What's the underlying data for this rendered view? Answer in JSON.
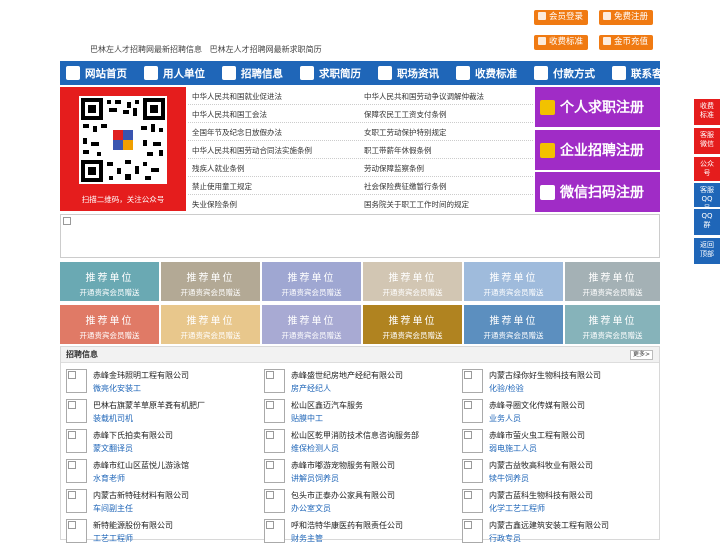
{
  "top_buttons": [
    {
      "label": "会员登录",
      "icon": "user-icon"
    },
    {
      "label": "免费注册",
      "icon": "register-icon"
    },
    {
      "label": "收费标准",
      "icon": "price-icon"
    },
    {
      "label": "金币充值",
      "icon": "coin-icon"
    }
  ],
  "tagline": "巴林左人才招聘网最新招聘信息   巴林左人才招聘网最新求职简历",
  "nav": [
    {
      "label": "网站首页",
      "icon": "home-icon"
    },
    {
      "label": "用人单位",
      "icon": "building-icon"
    },
    {
      "label": "招聘信息",
      "icon": "recruit-icon"
    },
    {
      "label": "求职简历",
      "icon": "resume-icon"
    },
    {
      "label": "职场资讯",
      "icon": "news-icon"
    },
    {
      "label": "收费标准",
      "icon": "fee-icon"
    },
    {
      "label": "付款方式",
      "icon": "payment-icon"
    },
    {
      "label": "联系客服",
      "icon": "service-icon"
    }
  ],
  "qr_caption": "扫描二维码，关注公众号",
  "law_links": [
    "中华人民共和国就业促进法",
    "中华人民共和国劳动争议调解仲裁法",
    "中华人民共和国工会法",
    "保障农民工工资支付条例",
    "全国年节及纪念日放假办法",
    "女职工劳动保护特别规定",
    "中华人民共和国劳动合同法实施条例",
    "职工带薪年休假条例",
    "残疾人就业条例",
    "劳动保障监察条例",
    "禁止使用童工规定",
    "社会保险费征缴暂行条例",
    "失业保险条例",
    "国务院关于职工工作时间的规定"
  ],
  "register_buttons": [
    {
      "label": "个人求职注册",
      "icon": "person-icon"
    },
    {
      "label": "企业招聘注册",
      "icon": "enterprise-icon"
    },
    {
      "label": "微信扫码注册",
      "icon": "wechat-icon"
    }
  ],
  "promo": {
    "title": "推荐单位",
    "sub": "开通贵宾会员赠送"
  },
  "promo_colors": [
    "#6aa9b3",
    "#b3a995",
    "#9fa7d2",
    "#d2c6b3",
    "#9fbbdc",
    "#a4b1b5",
    "#e07a66",
    "#e8c78c",
    "#a8aad3",
    "#b08320",
    "#5c8fbf",
    "#86b3ba"
  ],
  "jobs_title": "招聘信息",
  "more_label": "更多>",
  "jobs": [
    {
      "company": "赤峰金玮照明工程有限公司",
      "position": "微亮化安装工"
    },
    {
      "company": "赤峰盛世纪房地产经纪有限公司",
      "position": "房产经纪人"
    },
    {
      "company": "内蒙古绿你好生物科技有限公司",
      "position": "化验/检验"
    },
    {
      "company": "巴林右旗蒙羊草原羊粪有机肥厂",
      "position": "装载机司机"
    },
    {
      "company": "松山区鑫迈汽车服务",
      "position": "贴膜中工"
    },
    {
      "company": "赤峰寻圈文化传媒有限公司",
      "position": "业务人员"
    },
    {
      "company": "赤峰下氏拍卖有限公司",
      "position": "蒙文翻译员"
    },
    {
      "company": "松山区乾甲消防技术信息咨询服务部",
      "position": "维保检测人员"
    },
    {
      "company": "赤峰市萤火虫工程有限公司",
      "position": "弱电施工人员"
    },
    {
      "company": "赤峰市红山区蓝悦儿游泳馆",
      "position": "水育老师"
    },
    {
      "company": "赤峰市嘟游宠物服务有限公司",
      "position": "讲解员饲养员"
    },
    {
      "company": "内蒙古益牧高科牧业有限公司",
      "position": "犊牛饲养员"
    },
    {
      "company": "内蒙古新特硅材料有限公司",
      "position": "车间副主任"
    },
    {
      "company": "包头市正泰办公家具有限公司",
      "position": "办公室文员"
    },
    {
      "company": "内蒙古蓝科生物科技有限公司",
      "position": "化学工艺工程师"
    },
    {
      "company": "新特能源股份有限公司",
      "position": "工艺工程师"
    },
    {
      "company": "呼和浩特华康医药有限责任公司",
      "position": "财务主管"
    },
    {
      "company": "内蒙古鑫远建筑安装工程有限公司",
      "position": "行政专员"
    }
  ],
  "side_items": [
    {
      "label": "收费标准",
      "icon": "fee-icon"
    },
    {
      "label": "客服微信",
      "icon": "wechat-icon"
    },
    {
      "label": "公众号",
      "icon": "official-account-icon"
    },
    {
      "label": "客服QQ号",
      "icon": "qq-icon"
    },
    {
      "label": "QQ群",
      "icon": "qq-group-icon"
    },
    {
      "label": "返回顶部",
      "icon": "back-top-icon"
    }
  ]
}
